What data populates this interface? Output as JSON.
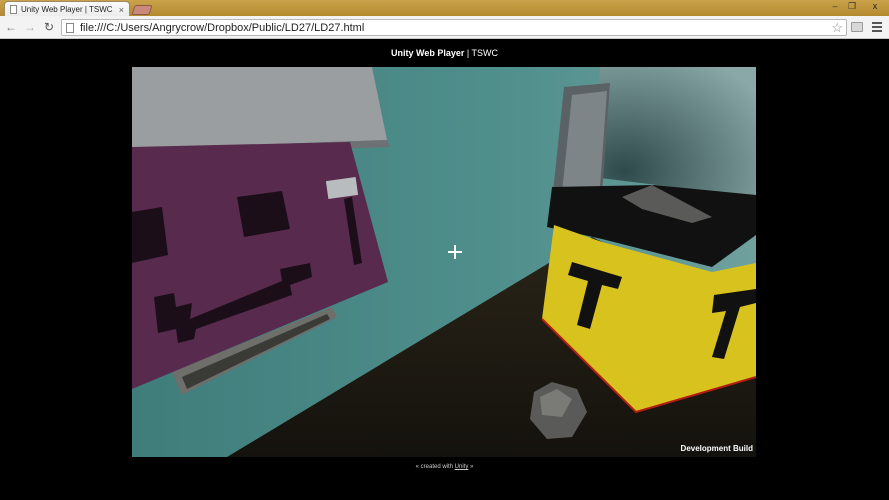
{
  "browser": {
    "tab_title": "Unity Web Player | TSWC",
    "tab_close": "×",
    "window_controls": {
      "minimize": "–",
      "maximize": "❐",
      "close": "x"
    },
    "nav": {
      "back": "←",
      "forward": "→",
      "reload": "↻"
    },
    "url": "file:///C:/Users/Angrycrow/Dropbox/Public/LD27/LD27.html",
    "bookmark_star": "☆"
  },
  "page": {
    "title_bold": "Unity Web Player",
    "title_rest": " | TSWC",
    "footer_prefix": "« created with ",
    "footer_link": "Unity",
    "footer_suffix": " »"
  },
  "game": {
    "dev_build_label": "Development Build",
    "colors": {
      "wall": "#4b8a88",
      "floor": "#1a1712",
      "purple_cube": "#582a4e",
      "yellow_cube": "#d8c21e",
      "lid_grey": "#9a9ea0"
    }
  }
}
